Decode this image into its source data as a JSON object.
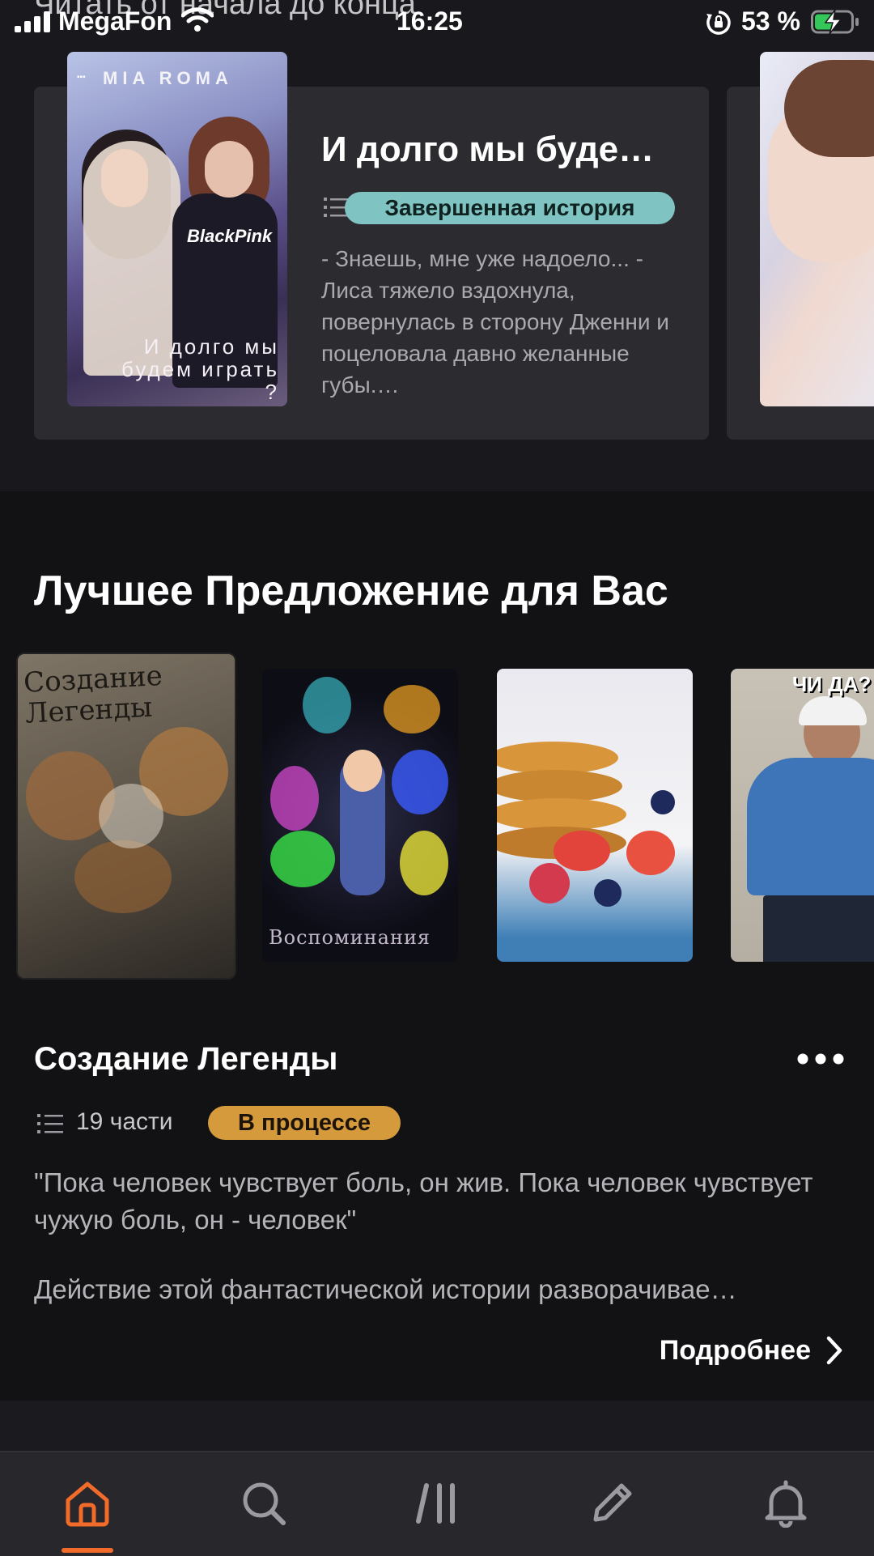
{
  "ghost_heading": "Читать от начала до конца",
  "status_bar": {
    "carrier": "MegaFon",
    "time": "16:25",
    "battery_percent": "53 %",
    "battery_level": 0.53
  },
  "featured_card": {
    "cover": {
      "brand": "MIA ROMA",
      "shirt_text": "BlackPink",
      "title": "И долго мы будем играть ?"
    },
    "title": "И долго мы буде…",
    "status": "Завершенная история",
    "excerpt": "- Знаешь, мне уже надоело... - Лиса тяжело вздохнула, повернулась в сторону Дженни и поцеловала давно желанные губы.…"
  },
  "section": {
    "title": "Лучшее Предложение для Вас"
  },
  "recommendations": {
    "covers": [
      {
        "text": "Создание Легенды"
      },
      {
        "text": "Воспоминания"
      },
      {
        "text": ""
      },
      {
        "text": "ЧИ ДА?"
      }
    ],
    "selected": {
      "title": "Создание Легенды",
      "parts": "19 части",
      "status": "В процессе",
      "quote": "\"Пока человек чувствует боль, он жив. Пока человек чувствует чужую боль, он - человек\"",
      "description": "Действие этой фантастической истории разворачивае…",
      "more_label": "Подробнее"
    }
  },
  "bottom_nav": {
    "items": [
      {
        "icon": "home-icon",
        "active": true
      },
      {
        "icon": "search-icon",
        "active": false
      },
      {
        "icon": "library-icon",
        "active": false
      },
      {
        "icon": "write-icon",
        "active": false
      },
      {
        "icon": "bell-icon",
        "active": false
      }
    ]
  },
  "colors": {
    "accent": "#f26b2a",
    "completed_badge": "#7fc4c2",
    "in_progress_badge": "#d49a3c",
    "background": "#121114",
    "card": "#2c2b30",
    "nav_bar": "#28272b"
  }
}
